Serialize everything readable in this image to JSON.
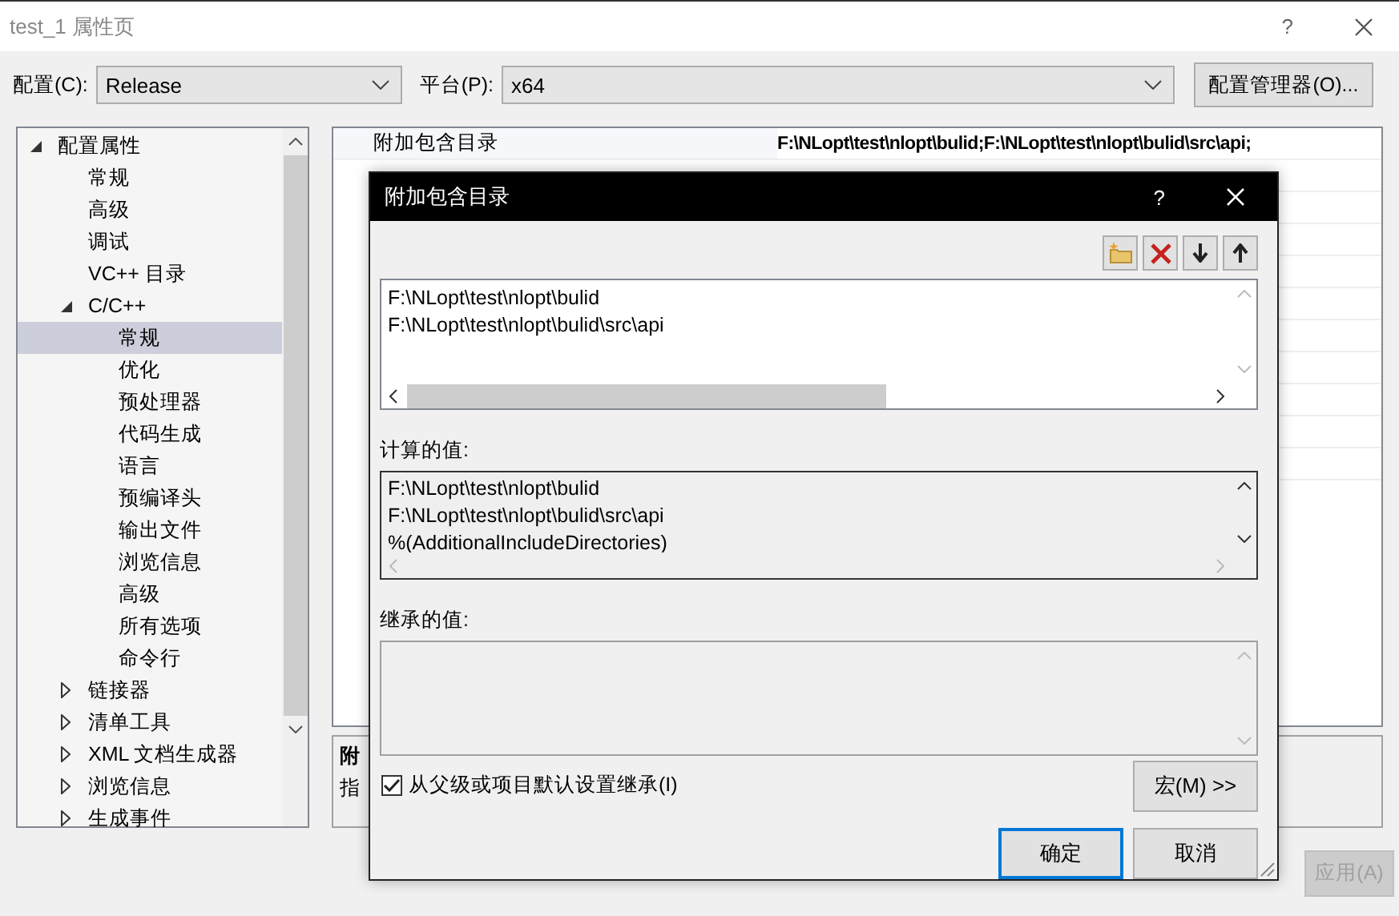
{
  "window": {
    "title": "test_1 属性页",
    "help": "?"
  },
  "config": {
    "label": "配置(C):",
    "value": "Release"
  },
  "platform": {
    "label": "平台(P):",
    "value": "x64"
  },
  "config_manager_button": "配置管理器(O)...",
  "tree": [
    {
      "label": "配置属性",
      "expanded": true,
      "selected": false,
      "children": [
        {
          "label": "常规",
          "selected": false
        },
        {
          "label": "高级",
          "selected": false
        },
        {
          "label": "调试",
          "selected": false
        },
        {
          "label": "VC++ 目录",
          "selected": false
        },
        {
          "label": "C/C++",
          "expanded": true,
          "selected": false,
          "children": [
            {
              "label": "常规",
              "selected": true
            },
            {
              "label": "优化",
              "selected": false
            },
            {
              "label": "预处理器",
              "selected": false
            },
            {
              "label": "代码生成",
              "selected": false
            },
            {
              "label": "语言",
              "selected": false
            },
            {
              "label": "预编译头",
              "selected": false
            },
            {
              "label": "输出文件",
              "selected": false
            },
            {
              "label": "浏览信息",
              "selected": false
            },
            {
              "label": "高级",
              "selected": false
            },
            {
              "label": "所有选项",
              "selected": false
            },
            {
              "label": "命令行",
              "selected": false
            }
          ]
        },
        {
          "label": "链接器",
          "expanded": false,
          "selected": false
        },
        {
          "label": "清单工具",
          "expanded": false,
          "selected": false
        },
        {
          "label": "XML 文档生成器",
          "expanded": false,
          "selected": false
        },
        {
          "label": "浏览信息",
          "expanded": false,
          "selected": false
        },
        {
          "label": "生成事件",
          "expanded": false,
          "selected": false
        }
      ]
    }
  ],
  "properties": [
    {
      "name": "附加包含目录",
      "value": "F:\\NLopt\\test\\nlopt\\bulid;F:\\NLopt\\test\\nlopt\\bulid\\src\\api;"
    }
  ],
  "description": {
    "title": "附",
    "text": "指"
  },
  "apply_button": {
    "label": "应用(A)",
    "disabled": true
  },
  "dialog": {
    "title": "附加包含目录",
    "help": "?",
    "entries": [
      "F:\\NLopt\\test\\nlopt\\bulid",
      "F:\\NLopt\\test\\nlopt\\bulid\\src\\api"
    ],
    "computed_label": "计算的值:",
    "computed": [
      "F:\\NLopt\\test\\nlopt\\bulid",
      "F:\\NLopt\\test\\nlopt\\bulid\\src\\api",
      "%(AdditionalIncludeDirectories)"
    ],
    "inherited_label": "继承的值:",
    "inherit": {
      "label": "从父级或项目默认设置继承(I)",
      "checked": true
    },
    "macro_button": "宏(M)  >>",
    "ok_button": "确定",
    "cancel_button": "取消"
  }
}
